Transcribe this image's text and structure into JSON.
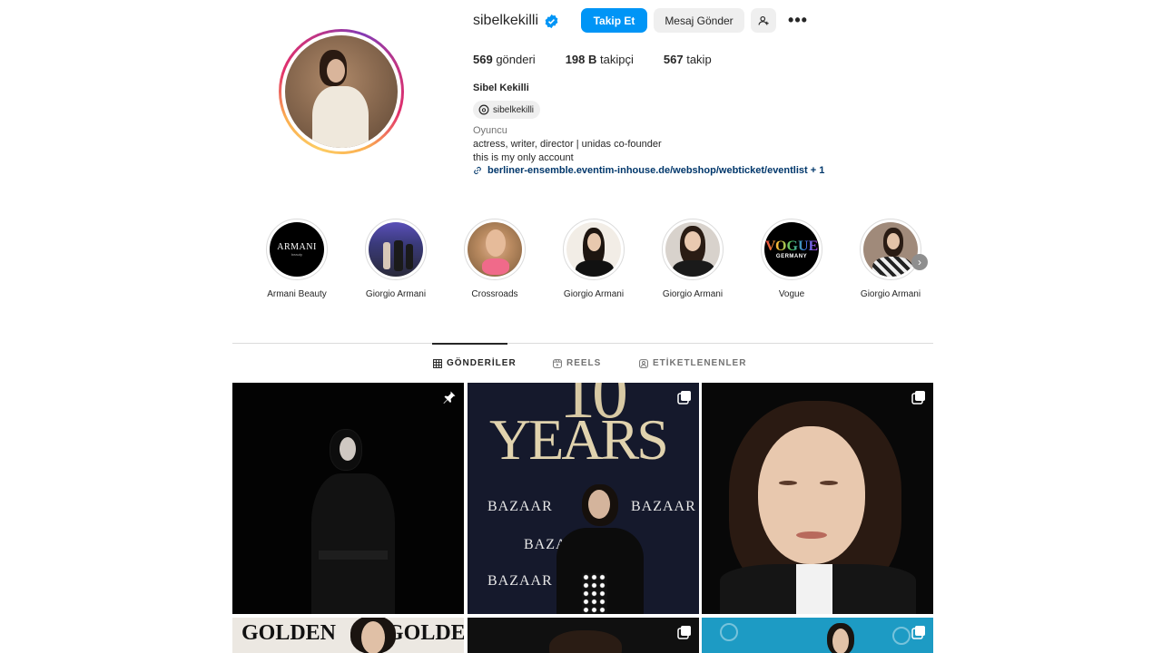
{
  "profile": {
    "username": "sibelkekilli",
    "full_name": "Sibel Kekilli",
    "threads_handle": "sibelkekilli",
    "category": "Oyuncu",
    "bio_line1": "actress, writer, director | unidas co-founder",
    "bio_line2": "this is my only account",
    "link": "berliner-ensemble.eventim-inhouse.de/webshop/webticket/eventlist + 1"
  },
  "actions": {
    "follow_label": "Takip Et",
    "message_label": "Mesaj Gönder",
    "more_label": "•••"
  },
  "stats": {
    "posts_count": "569",
    "posts_label": "gönderi",
    "followers_count": "198 B",
    "followers_label": "takipçi",
    "following_count": "567",
    "following_label": "takip"
  },
  "highlights": [
    {
      "label": "Armani Beauty"
    },
    {
      "label": "Giorgio Armani"
    },
    {
      "label": "Crossroads"
    },
    {
      "label": "Giorgio Armani"
    },
    {
      "label": "Giorgio Armani"
    },
    {
      "label": "Vogue"
    },
    {
      "label": "Giorgio Armani"
    }
  ],
  "highlight_logos": {
    "armani_text": "ARMANI",
    "armani_sub": "beauty",
    "vogue_text": "VOGUE",
    "vogue_sub": "GERMANY"
  },
  "tabs": [
    {
      "label": "GÖNDERİLER",
      "active": true,
      "icon": "grid-icon"
    },
    {
      "label": "REELS",
      "active": false,
      "icon": "reels-icon"
    },
    {
      "label": "ETİKETLENENLER",
      "active": false,
      "icon": "tagged-icon"
    }
  ],
  "posts": {
    "bazaar_text": "BAZAAR",
    "years_text": "YEARS",
    "golden_text": "GOLDEN"
  },
  "colors": {
    "accent": "#0095f6",
    "link": "#00376b",
    "verified": "#0095f6"
  }
}
